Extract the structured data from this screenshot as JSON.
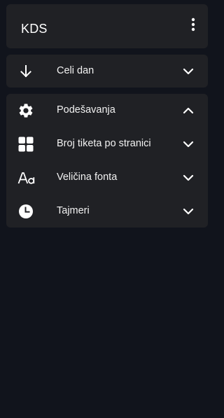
{
  "app": {
    "title": "KDS",
    "menu_icon": "more-vertical-icon"
  },
  "view_panel": {
    "item": {
      "label": "Celi dan",
      "icon": "arrow-down-icon",
      "expanded": false
    }
  },
  "settings_panel": {
    "header": {
      "label": "Podešavanja",
      "icon": "gear-icon",
      "expanded": true
    },
    "items": [
      {
        "label": "Broj tiketa po stranici",
        "icon": "grid-icon",
        "expanded": false
      },
      {
        "label": "Veličina fonta",
        "icon": "font-size-icon",
        "expanded": false
      },
      {
        "label": "Tajmeri",
        "icon": "clock-icon",
        "expanded": false
      }
    ]
  },
  "colors": {
    "background": "#11141c",
    "panel": "#202125",
    "text": "#ffffff"
  }
}
